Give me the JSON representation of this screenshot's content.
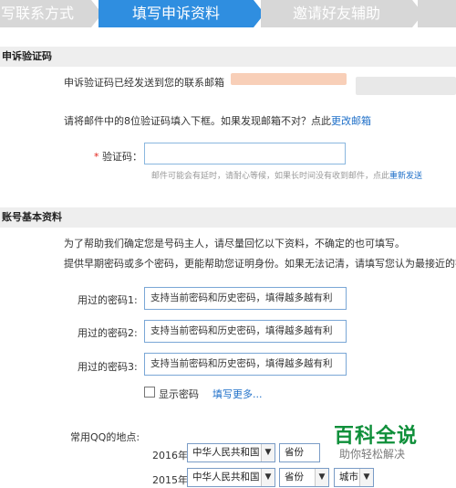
{
  "steps": [
    {
      "label": "写联系方式"
    },
    {
      "label": "填写申诉资料"
    },
    {
      "label": "邀请好友辅助"
    }
  ],
  "verify_section": {
    "title": "申诉验证码",
    "sent_text": "申诉验证码已经发送到您的联系邮箱",
    "instruction": "请将邮件中的8位验证码填入下框。如果发现邮箱不对？点此",
    "change_email_link": "更改邮箱",
    "required_mark": "*",
    "code_label": "验证码：",
    "code_value": "",
    "hint": "邮件可能会有延时，请耐心等候，如果长时间没有收到邮件，点此",
    "resend_link": "重新发送"
  },
  "account_section": {
    "title": "账号基本资料",
    "intro1": "为了帮助我们确定您是号码主人，请尽量回忆以下资料，不确定的也可填写。",
    "intro2": "提供早期密码或多个密码，更能帮助您证明身份。如果无法记清，请填写您认为最接近的密",
    "password_fields": [
      {
        "label": "用过的密码1:",
        "placeholder": "支持当前密码和历史密码，填得越多越有利"
      },
      {
        "label": "用过的密码2:",
        "placeholder": "支持当前密码和历史密码，填得越多越有利"
      },
      {
        "label": "用过的密码3:",
        "placeholder": "支持当前密码和历史密码，填得越多越有利"
      }
    ],
    "show_password_label": "显示密码",
    "show_password_checked": false,
    "fill_more_link": "填写更多...",
    "qq_location_label": "常用QQ的地点:",
    "locations": [
      {
        "year": "2016年",
        "country": "中华人民共和国",
        "province": "省份",
        "city": ""
      },
      {
        "year": "2015年",
        "country": "中华人民共和国",
        "province": "省份",
        "city": "城市"
      }
    ]
  },
  "watermark": {
    "main": "百科全说",
    "sub": "助你轻松解决"
  },
  "colors": {
    "tab_active": "#2f8ee0",
    "tab_inactive": "#d7d7d7",
    "link": "#1e6fc8",
    "required": "#e2231a"
  }
}
